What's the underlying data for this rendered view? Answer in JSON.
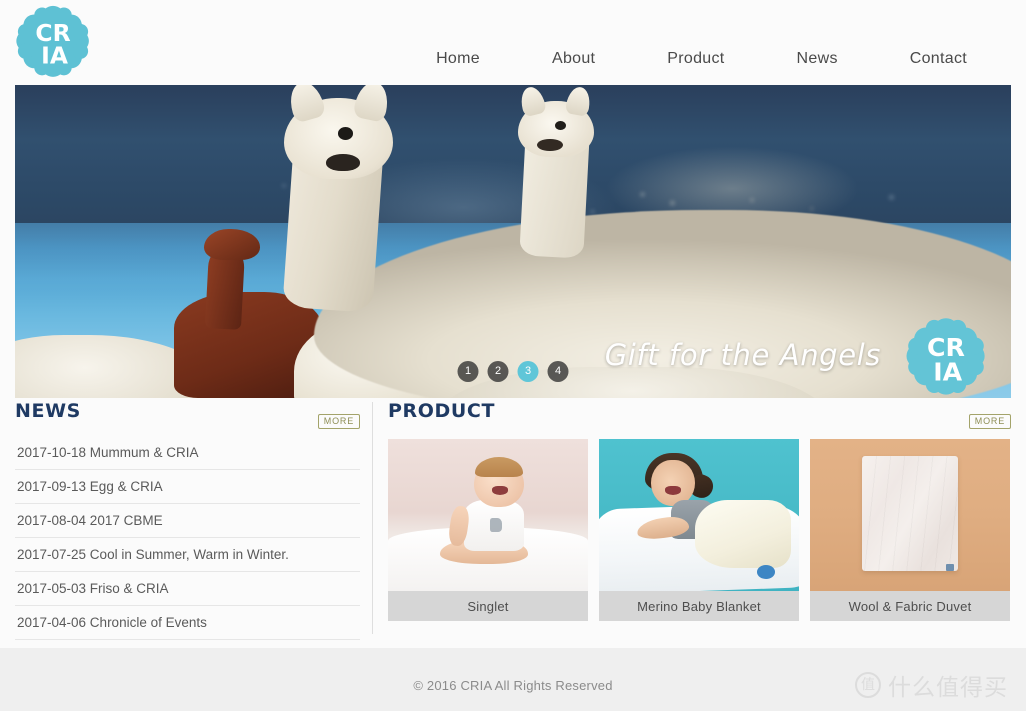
{
  "site": {
    "logo_text_top": "CR",
    "logo_text_bottom": "IA",
    "brand": "CRIA"
  },
  "nav": {
    "items": [
      {
        "label": "Home"
      },
      {
        "label": "About"
      },
      {
        "label": "Product"
      },
      {
        "label": "News"
      },
      {
        "label": "Contact"
      }
    ]
  },
  "hero": {
    "tagline": "Gift for the Angels",
    "logo_text_top": "CR",
    "logo_text_bottom": "IA",
    "slides": [
      {
        "label": "1",
        "active": false
      },
      {
        "label": "2",
        "active": false
      },
      {
        "label": "3",
        "active": true
      },
      {
        "label": "4",
        "active": false
      }
    ],
    "active_slide": "3"
  },
  "news": {
    "title": "NEWS",
    "more_label": "MORE",
    "items": [
      {
        "text": "2017-10-18 Mummum & CRIA"
      },
      {
        "text": "2017-09-13 Egg & CRIA"
      },
      {
        "text": "2017-08-04 2017 CBME"
      },
      {
        "text": "2017-07-25 Cool in Summer, Warm in Winter."
      },
      {
        "text": "2017-05-03 Friso & CRIA"
      },
      {
        "text": "2017-04-06 Chronicle of Events"
      }
    ]
  },
  "product": {
    "title": "PRODUCT",
    "more_label": "MORE",
    "items": [
      {
        "name": "Singlet"
      },
      {
        "name": "Merino Baby Blanket"
      },
      {
        "name": "Wool & Fabric Duvet"
      }
    ]
  },
  "footer": {
    "copyright": "© 2016  CRIA All Rights Reserved"
  },
  "watermark": {
    "badge": "值",
    "text": "什么值得买"
  },
  "colors": {
    "brand_blue": "#5ec1d4",
    "heading_navy": "#1f3a63",
    "more_border": "#a3a36a",
    "page_bg": "#efefef",
    "card_bg": "#fbfbfb"
  }
}
